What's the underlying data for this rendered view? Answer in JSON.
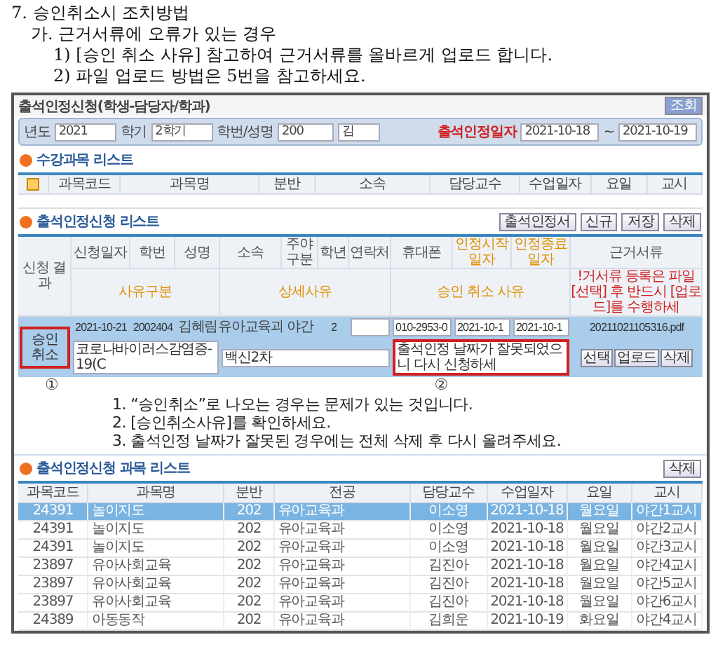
{
  "doc": {
    "heading": "7. 승인취소시 조치방법",
    "subheading": "가. 근거서류에 오류가 있는 경우",
    "steps": [
      "1) [승인 취소 사유] 참고하여 근거서류를 올바르게 업로드 합니다.",
      "2) 파일 업로드 방법은 5번을 참고하세요."
    ]
  },
  "window": {
    "title": "출석인정신청(학생-담당자/학과)",
    "query_button": "조회",
    "filters": {
      "year_label": "년도",
      "year": "2021",
      "term_label": "학기",
      "term": "2학기",
      "student_label": "학번/성명",
      "student": "200",
      "name": "김",
      "date_label": "출석인정일자",
      "date_from": "2021-10-18",
      "tilde": "~",
      "date_to": "2021-10-19"
    },
    "courses": {
      "title": "수강과목 리스트",
      "all_checked": true,
      "columns": [
        "과목코드",
        "과목명",
        "분반",
        "소속",
        "담당교수",
        "수업일자",
        "요일",
        "교시"
      ]
    },
    "applications": {
      "title": "출석인정신청 리스트",
      "buttons": [
        "출석인정서",
        "신규",
        "저장",
        "삭제"
      ],
      "header_top": [
        "신청일자",
        "학번",
        "성명",
        "소속",
        "주야구분",
        "학년",
        "연락처",
        "휴대폰",
        "인정시작일자",
        "인정종료일자",
        "근거서류"
      ],
      "result_header": "신청 결과",
      "header_bottom": [
        "사유구분",
        "상세사유",
        "승인 취소 사유",
        "!거서류 등록은 파일 [선택] 후 반드시 [업로드]를 수행하세"
      ],
      "row": {
        "result": "승인취소",
        "date": "2021-10-21",
        "student_no": "2002404",
        "name": "김혜림",
        "dept": "유아교육과",
        "shift": "야간",
        "grade": "2",
        "mobile": "010-2953-0",
        "start": "2021-10-1",
        "end": "2021-10-1",
        "file": "20211021105316.pdf",
        "reason_type": "코로나바이러스감염증-19(C",
        "detail": "백신2차",
        "cancel_reason": "출석인정 날짜가 잘못되었으니 다시 신청하세",
        "file_buttons": [
          "선택",
          "업로드",
          "삭제"
        ]
      },
      "callouts": [
        "①",
        "②"
      ],
      "notes": [
        "1. “승인취소”로 나오는 경우는 문제가 있는 것입니다.",
        "2. [승인취소사유]를 확인하세요.",
        "3. 출석인정 날짜가 잘못된 경우에는 전체 삭제 후 다시 올려주세요."
      ]
    },
    "subjects": {
      "title": "출석인정신청 과목 리스트",
      "delete_button": "삭제",
      "columns": [
        "과목코드",
        "과목명",
        "분반",
        "전공",
        "담당교수",
        "수업일자",
        "요일",
        "교시"
      ],
      "rows": [
        {
          "selected": true,
          "cells": [
            "24391",
            "놀이지도",
            "202",
            "유아교육과",
            "이소영",
            "2021-10-18",
            "월요일",
            "야간1교시"
          ]
        },
        {
          "selected": false,
          "cells": [
            "24391",
            "놀이지도",
            "202",
            "유아교육과",
            "이소영",
            "2021-10-18",
            "월요일",
            "야간2교시"
          ]
        },
        {
          "selected": false,
          "cells": [
            "24391",
            "놀이지도",
            "202",
            "유아교육과",
            "이소영",
            "2021-10-18",
            "월요일",
            "야간3교시"
          ]
        },
        {
          "selected": false,
          "cells": [
            "23897",
            "유아사회교육",
            "202",
            "유아교육과",
            "김진아",
            "2021-10-18",
            "월요일",
            "야간4교시"
          ]
        },
        {
          "selected": false,
          "cells": [
            "23897",
            "유아사회교육",
            "202",
            "유아교육과",
            "김진아",
            "2021-10-18",
            "월요일",
            "야간5교시"
          ]
        },
        {
          "selected": false,
          "cells": [
            "23897",
            "유아사회교육",
            "202",
            "유아교육과",
            "김진아",
            "2021-10-18",
            "월요일",
            "야간6교시"
          ]
        },
        {
          "selected": false,
          "cells": [
            "24389",
            "아동동작",
            "202",
            "유아교육과",
            "김희운",
            "2021-10-19",
            "화요일",
            "야간4교시"
          ]
        }
      ]
    }
  }
}
